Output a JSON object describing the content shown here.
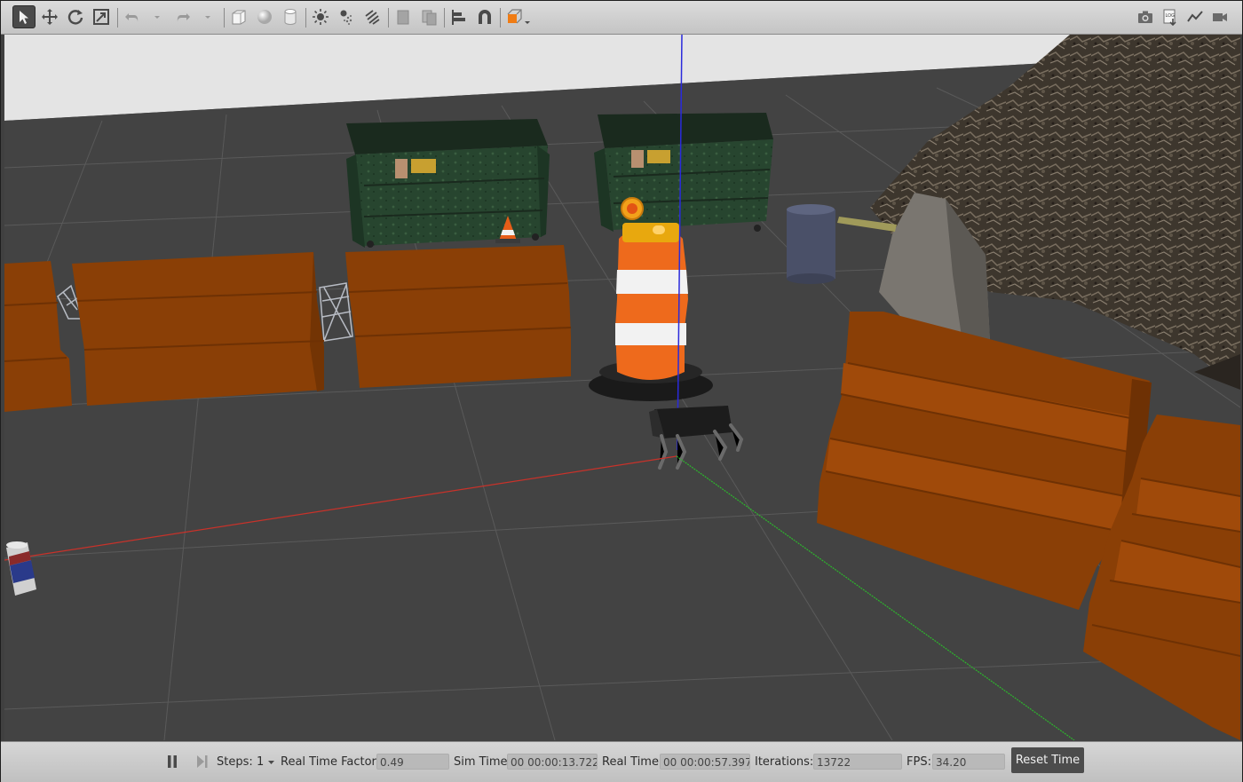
{
  "toolbar": {
    "left_tools": [
      {
        "name": "select-mode-icon",
        "active": true
      },
      {
        "name": "translate-mode-icon"
      },
      {
        "name": "rotate-mode-icon"
      },
      {
        "name": "scale-mode-icon"
      },
      {
        "name": "undo-icon"
      },
      {
        "name": "redo-icon"
      },
      {
        "name": "box-shape-icon"
      },
      {
        "name": "sphere-shape-icon"
      },
      {
        "name": "cylinder-shape-icon"
      },
      {
        "name": "point-light-icon"
      },
      {
        "name": "spot-light-icon"
      },
      {
        "name": "directional-light-icon"
      },
      {
        "name": "copy-icon"
      },
      {
        "name": "paste-icon"
      },
      {
        "name": "align-icon"
      },
      {
        "name": "snap-icon"
      },
      {
        "name": "view-angle-icon"
      }
    ],
    "right_tools": [
      {
        "name": "screenshot-icon"
      },
      {
        "name": "log-icon"
      },
      {
        "name": "plot-icon"
      },
      {
        "name": "record-video-icon"
      }
    ]
  },
  "bottombar": {
    "steps_label": "Steps:",
    "steps_value": "1",
    "rtf_label": "Real Time Factor:",
    "rtf_value": "0.49",
    "sim_time_label": "Sim Time:",
    "sim_time_value": "00 00:00:13.722",
    "real_time_label": "Real Time:",
    "real_time_value": "00 00:00:57.397",
    "iterations_label": "Iterations:",
    "iterations_value": "13722",
    "fps_label": "FPS:",
    "fps_value": "34.20",
    "reset_time_label": "Reset Time"
  },
  "colors": {
    "barrier": "#8a3f06",
    "barrier_dark": "#6e3104",
    "drum_orange": "#ee6a1c",
    "dumpster": "#27452f",
    "ground": "#434343",
    "sky": "#e4e4e4",
    "axis_x": "#c8322a",
    "axis_y": "#2db52d",
    "axis_z": "#2a2adc"
  }
}
